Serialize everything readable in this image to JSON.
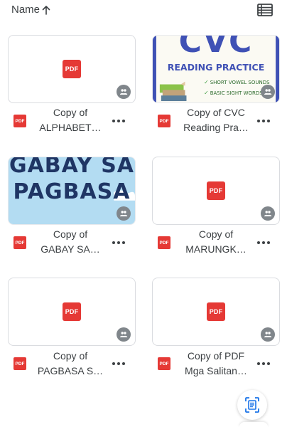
{
  "header": {
    "sort_label": "Name",
    "sort_direction_icon": "arrow-up-icon",
    "view_toggle_icon": "list-view-icon"
  },
  "file_type_label": "PDF",
  "shared_icon": "people-icon",
  "more_icon": "more-horiz-icon",
  "files": [
    {
      "line1": "Copy of",
      "line2": "ALPHABET…",
      "thumbnail": "pdf-icon"
    },
    {
      "line1": "Copy of CVC",
      "line2": "Reading Pra…",
      "thumbnail": "preview",
      "preview": {
        "heading": "CVC",
        "subheading": "READING PRACTICE",
        "items": [
          "SHORT VOWEL SOUNDS",
          "BASIC SIGHT WORDS"
        ]
      }
    },
    {
      "line1": "Copy of",
      "line2": "GABAY SA…",
      "thumbnail": "preview",
      "preview": {
        "line1": "GABAY SA",
        "line2": "PAGBASA"
      }
    },
    {
      "line1": "Copy of",
      "line2": "MARUNGK…",
      "thumbnail": "pdf-icon"
    },
    {
      "line1": "Copy of",
      "line2": "PAGBASA S…",
      "thumbnail": "pdf-icon"
    },
    {
      "line1": "Copy of PDF",
      "line2": "Mga Salitan…",
      "thumbnail": "pdf-icon"
    }
  ],
  "fab_icon": "scan-document-icon",
  "colors": {
    "pdf_red": "#e53935",
    "card_border": "#dadce0",
    "text": "#3c4043",
    "shared_badge": "#80868b",
    "fab_icon": "#1a73e8",
    "cvc_blue": "#3f51b5",
    "gabay_sky": "#b3dcf2",
    "gabay_text": "#1f3564"
  }
}
